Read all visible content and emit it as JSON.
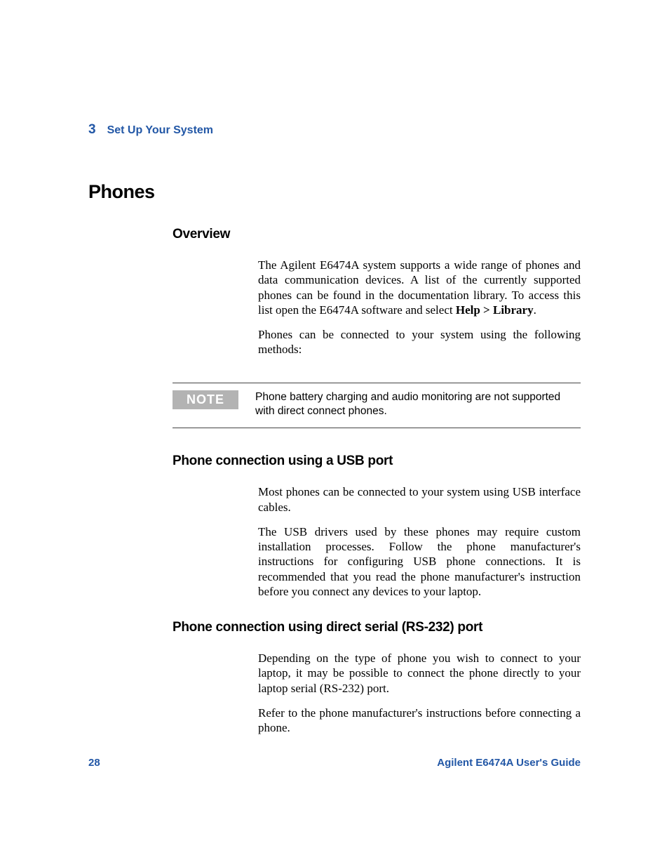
{
  "header": {
    "chapter_number": "3",
    "chapter_title": "Set Up Your System"
  },
  "section_title": "Phones",
  "overview": {
    "heading": "Overview",
    "para1_pre": "The Agilent E6474A system supports a wide range of phones and data communication devices. A list of the currently supported phones can be found in the documentation library. To access this list open the E6474A software and select ",
    "para1_bold": "Help > Library",
    "para1_post": ".",
    "para2": "Phones can be connected to your system using the following methods:"
  },
  "note": {
    "label": "NOTE",
    "text": "Phone battery charging and audio monitoring are not supported with direct connect phones."
  },
  "usb": {
    "heading": "Phone connection using a USB port",
    "para1": "Most phones can be connected to your system using USB interface cables.",
    "para2": "The USB drivers used by these phones may require custom installation processes. Follow the phone manufacturer's instructions for configuring USB phone connections. It is recommended that you read the phone manufacturer's instruction before you connect any devices to your laptop."
  },
  "serial": {
    "heading": "Phone connection using direct serial (RS-232) port",
    "para1": "Depending on the type of phone you wish to connect to your laptop, it may be possible to connect the phone directly to your laptop serial (RS-232) port.",
    "para2": "Refer to the phone manufacturer's instructions before connecting a phone."
  },
  "footer": {
    "page_number": "28",
    "guide_title": "Agilent E6474A User's Guide"
  }
}
